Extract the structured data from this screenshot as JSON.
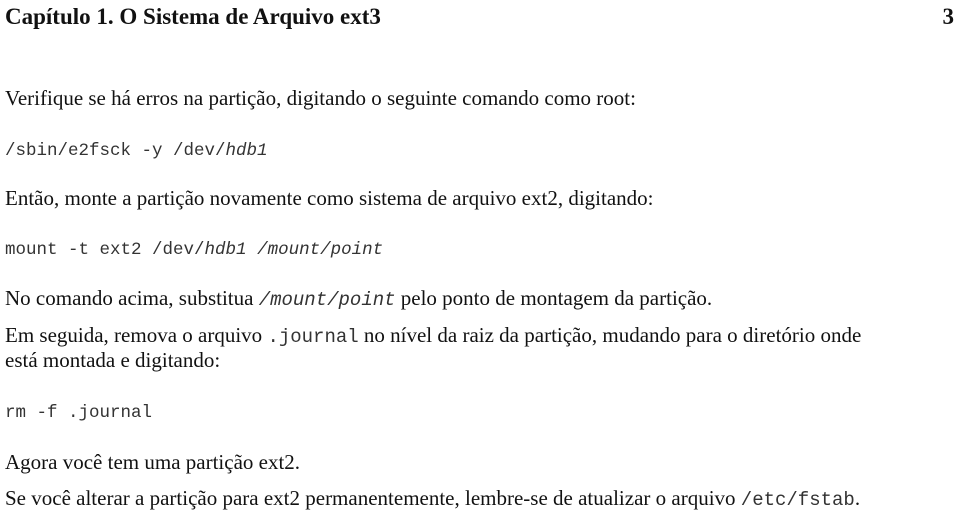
{
  "header": {
    "chapter_title": "Capítulo 1. O Sistema de Arquivo ext3",
    "page_number": "3"
  },
  "body": {
    "p1": "Verifique se há erros na partição, digitando o seguinte comando como root:",
    "cmd1": {
      "prefix": "/sbin/e2fsck -y /dev/",
      "device": "hdb1"
    },
    "p2": "Então, monte a partição novamente como sistema de arquivo ext2, digitando:",
    "cmd2": {
      "prefix": "mount -t ext2 /dev/",
      "device": "hdb1",
      "sep": " ",
      "mountpoint": "/mount/point"
    },
    "p3": {
      "before": "No comando acima, substitua ",
      "code": "/mount/point",
      "after": " pelo ponto de montagem da partição."
    },
    "p4": {
      "before": "Em seguida, remova o arquivo ",
      "code": ".journal",
      "after": " no nível da raiz da partição, mudando para o diretório onde",
      "line2": "está montada e digitando:"
    },
    "cmd3": "rm -f .journal",
    "p5": "Agora você tem uma partição ext2.",
    "p6": {
      "before": "Se você alterar a partição para ext2 permanentemente, lembre-se de atualizar o arquivo ",
      "code": "/etc/fstab",
      "after": "."
    }
  }
}
